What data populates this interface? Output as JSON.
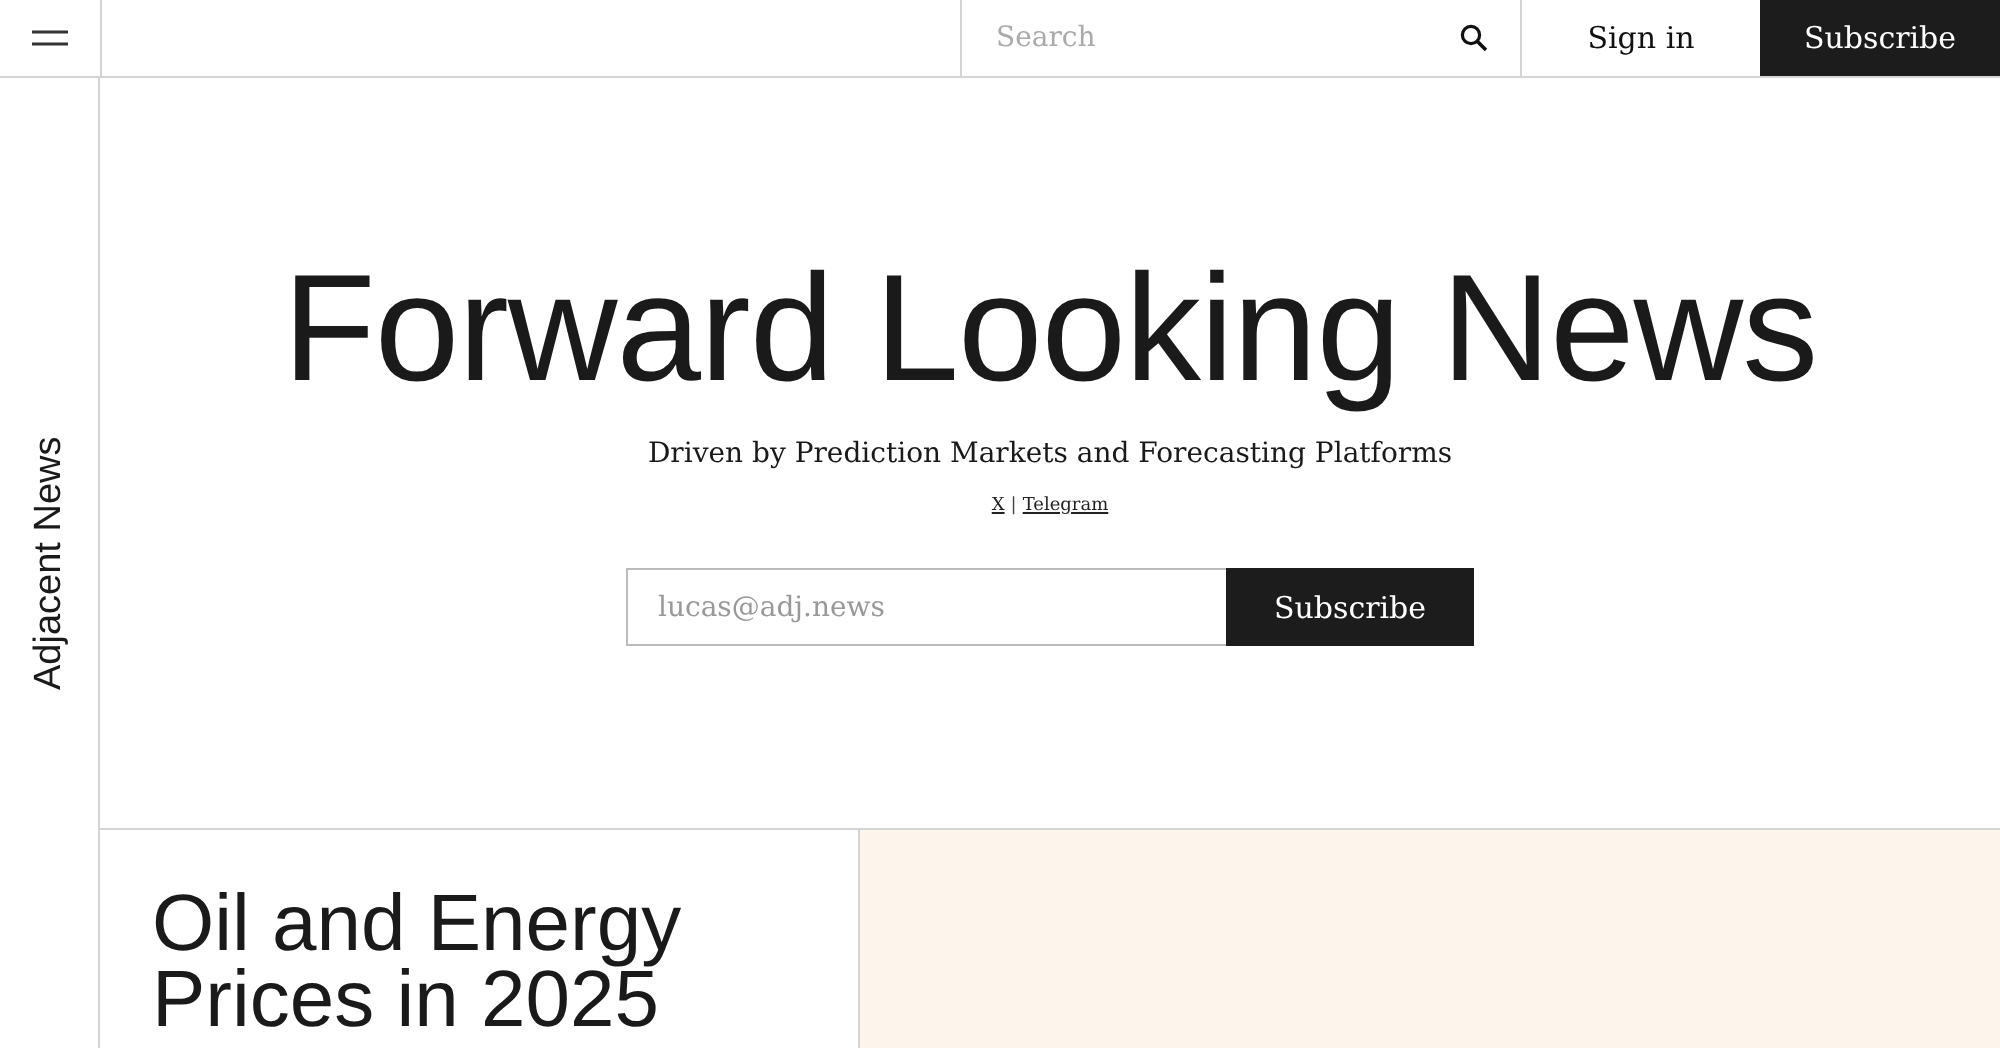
{
  "header": {
    "search": {
      "placeholder": "Search"
    },
    "sign_in": "Sign in",
    "subscribe": "Subscribe"
  },
  "sidebar": {
    "brand": "Adjacent News"
  },
  "hero": {
    "title": "Forward Looking News",
    "subtitle": "Driven by Prediction Markets and Forecasting Platforms",
    "links": [
      {
        "label": "X"
      },
      {
        "label": "Telegram"
      }
    ],
    "separator": "|",
    "signup": {
      "placeholder": "lucas@adj.news",
      "button": "Subscribe"
    }
  },
  "feature": {
    "title": "Oil and Energy Prices in 2025"
  }
}
